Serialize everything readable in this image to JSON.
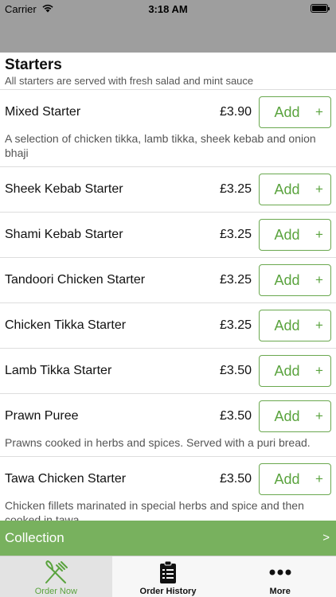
{
  "status_bar": {
    "carrier": "Carrier",
    "time": "3:18 AM"
  },
  "section": {
    "title": "Starters",
    "subtitle": "All starters are served with fresh salad and mint sauce"
  },
  "items": [
    {
      "name": "Mixed Starter",
      "price": "£3.90",
      "add_label": "Add",
      "plus": "+",
      "description": "A selection of chicken tikka, lamb tikka, sheek kebab and onion bhaji"
    },
    {
      "name": "Sheek Kebab Starter",
      "price": "£3.25",
      "add_label": "Add",
      "plus": "+"
    },
    {
      "name": "Shami Kebab Starter",
      "price": "£3.25",
      "add_label": "Add",
      "plus": "+"
    },
    {
      "name": "Tandoori Chicken Starter",
      "price": "£3.25",
      "add_label": "Add",
      "plus": "+"
    },
    {
      "name": "Chicken Tikka Starter",
      "price": "£3.25",
      "add_label": "Add",
      "plus": "+"
    },
    {
      "name": "Lamb Tikka Starter",
      "price": "£3.50",
      "add_label": "Add",
      "plus": "+"
    },
    {
      "name": "Prawn Puree",
      "price": "£3.50",
      "add_label": "Add",
      "plus": "+",
      "description": "Prawns cooked in herbs and spices. Served with a puri bread."
    },
    {
      "name": "Tawa Chicken Starter",
      "price": "£3.50",
      "add_label": "Add",
      "plus": "+",
      "description": "Chicken fillets marinated in special herbs and spice and then cooked in tawa."
    }
  ],
  "collection": {
    "label": "Collection",
    "chevron": ">"
  },
  "tabs": [
    {
      "label": "Order Now",
      "icon": "fork-knife-icon",
      "active": true
    },
    {
      "label": "Order History",
      "icon": "clipboard-icon",
      "active": false
    },
    {
      "label": "More",
      "icon": "more-dots-icon",
      "active": false
    }
  ],
  "colors": {
    "accent": "#78b15e",
    "accent_text": "#5aa33e",
    "header_gray": "#9e9e9e"
  }
}
